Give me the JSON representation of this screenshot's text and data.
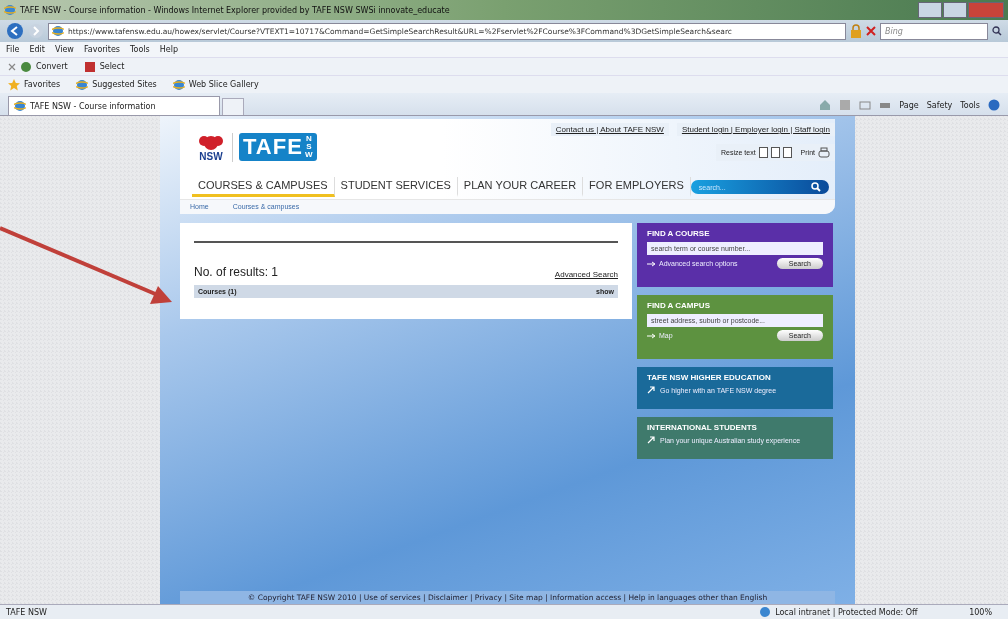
{
  "browser": {
    "title": "TAFE NSW - Course information - Windows Internet Explorer provided by TAFE NSW SWSi innovate_educate",
    "url": "https://www.tafensw.edu.au/howex/servlet/Course?VTEXT1=10717&Command=GetSimpleSearchResult&URL=%2Fservlet%2FCourse%3FCommand%3DGetSimpleSearch&searc",
    "search_placeholder": "Bing",
    "menu": [
      "File",
      "Edit",
      "View",
      "Favorites",
      "Tools",
      "Help"
    ],
    "command_bar": [
      "Convert",
      "Select"
    ],
    "favorites": [
      "Favorites",
      "Suggested Sites",
      "Web Slice Gallery"
    ],
    "tab": "TAFE NSW - Course information",
    "tools": [
      "Page",
      "Safety",
      "Tools"
    ]
  },
  "site": {
    "top_links": [
      "Contact us | About TAFE NSW",
      "Student login | Employer login | Staff login"
    ],
    "resize_label": "Resize text",
    "print_label": "Print",
    "logo": "TAFE",
    "logo_sub": "NSW",
    "gov_label": "NSW",
    "nav": [
      {
        "label": "COURSES & CAMPUSES",
        "selected": true
      },
      {
        "label": "STUDENT SERVICES",
        "selected": false
      },
      {
        "label": "PLAN YOUR CAREER",
        "selected": false
      },
      {
        "label": "FOR EMPLOYERS",
        "selected": false
      }
    ],
    "search_placeholder": "search...",
    "breadcrumb": [
      "Home",
      "Courses & campuses"
    ],
    "results": {
      "count_label": "No. of results: 1",
      "advanced_link": "Advanced Search",
      "groups": [
        {
          "label": "Courses (1)",
          "toggle": "show"
        }
      ]
    },
    "panels": [
      {
        "kind": "search",
        "title": "FIND A COURSE",
        "color": "#5a2fa8",
        "placeholder": "search term or course number...",
        "link": "Advanced search options",
        "button": "Search"
      },
      {
        "kind": "search",
        "title": "FIND A CAMPUS",
        "color": "#5d9240",
        "placeholder": "street address, suburb or postcode...",
        "link": "Map",
        "button": "Search"
      },
      {
        "kind": "promo",
        "title": "TAFE NSW HIGHER EDUCATION",
        "color": "#1a6a9a",
        "link": "Go higher with an TAFE NSW degree"
      },
      {
        "kind": "promo",
        "title": "INTERNATIONAL STUDENTS",
        "color": "#3f7a6c",
        "link": "Plan your unique Australian study experience"
      }
    ],
    "footer": "© Copyright TAFE NSW 2010 | Use of services | Disclaimer | Privacy | Site map | Information access | Help in languages other than English"
  },
  "status_bar": {
    "text": "TAFE NSW",
    "zone": "Local intranet | Protected Mode: Off",
    "zoom": "100%"
  }
}
